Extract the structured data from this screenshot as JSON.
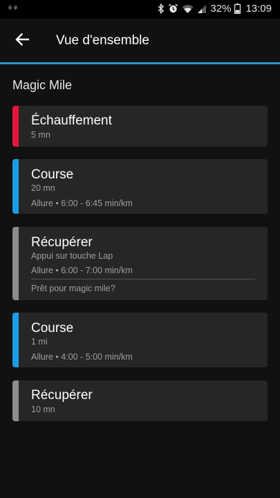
{
  "status_bar": {
    "notification_icons": "⚘⚘",
    "battery_percent": "32%",
    "time": "13:09"
  },
  "header": {
    "title": "Vue d'ensemble",
    "back_icon": "arrow-left-icon"
  },
  "workout": {
    "name": "Magic Mile"
  },
  "colors": {
    "warmup": "#e8163c",
    "run": "#1c9ce6",
    "recover": "#8c8c8c",
    "accent_line": "#2d95d2"
  },
  "steps": [
    {
      "name": "Échauffement",
      "duration": "5 mn",
      "type": "warmup"
    },
    {
      "name": "Course",
      "duration": "20 mn",
      "target": "Allure • 6:00 - 6:45 min/km",
      "type": "run"
    },
    {
      "name": "Récupérer",
      "duration": "Appui sur touche Lap",
      "target": "Allure • 6:00 - 7:00 min/km",
      "note": "Prêt pour magic mile?",
      "type": "recover"
    },
    {
      "name": "Course",
      "duration": "1 mi",
      "target": "Allure • 4:00 - 5:00 min/km",
      "type": "run"
    },
    {
      "name": "Récupérer",
      "duration": "10 mn",
      "type": "recover"
    }
  ]
}
